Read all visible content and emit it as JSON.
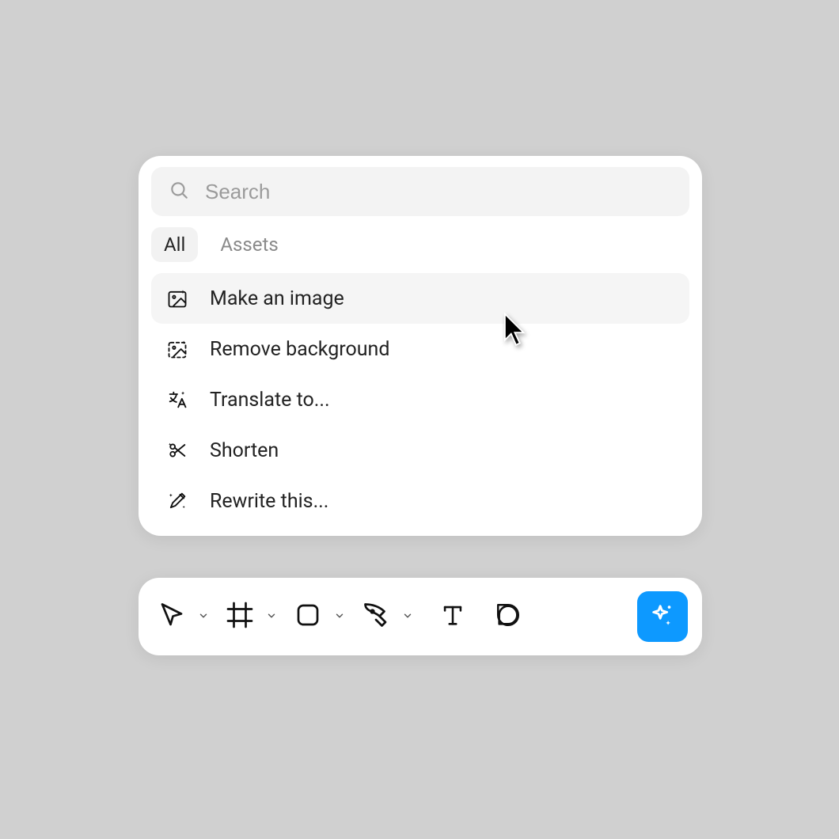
{
  "search": {
    "placeholder": "Search"
  },
  "tabs": {
    "all": "All",
    "assets": "Assets"
  },
  "menu": {
    "make_image": "Make an image",
    "remove_bg": "Remove background",
    "translate": "Translate to...",
    "shorten": "Shorten",
    "rewrite": "Rewrite this..."
  },
  "hovered_index": 0,
  "colors": {
    "accent": "#0d99ff"
  }
}
